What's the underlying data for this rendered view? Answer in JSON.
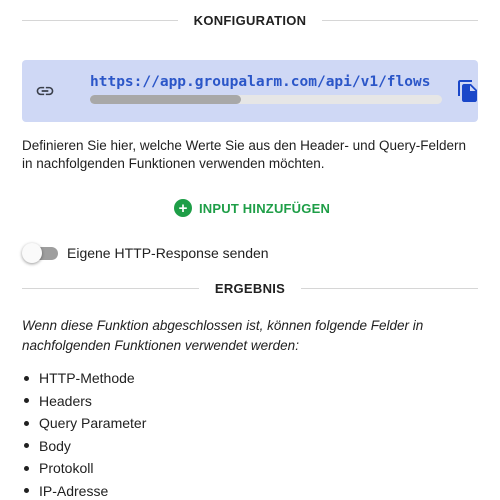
{
  "config": {
    "heading": "KONFIGURATION",
    "url": "https://app.groupalarm.com/api/v1/flows",
    "url_scroll_fraction": 0.43,
    "description": "Definieren Sie hier, welche Werte Sie aus den Header- und Query-Feldern in nachfolgenden Funktionen verwenden möchten.",
    "add_input_label": "INPUT HINZUFÜGEN",
    "toggle_label": "Eigene HTTP-Response senden",
    "toggle_on": false
  },
  "result": {
    "heading": "ERGEBNIS",
    "description": "Wenn diese Funktion abgeschlossen ist, können folgende Felder in nachfolgenden Funktionen verwendet werden:",
    "fields": [
      "HTTP-Methode",
      "Headers",
      "Query Parameter",
      "Body",
      "Protokoll",
      "IP-Adresse"
    ]
  },
  "colors": {
    "accent_green": "#1e9e47",
    "url_blue": "#2b56c8",
    "url_box_bg": "#cfd8f5",
    "copy_icon": "#1a47c9"
  },
  "icons": {
    "link": "link-icon",
    "copy": "copy-icon",
    "add": "plus-circle-icon"
  }
}
